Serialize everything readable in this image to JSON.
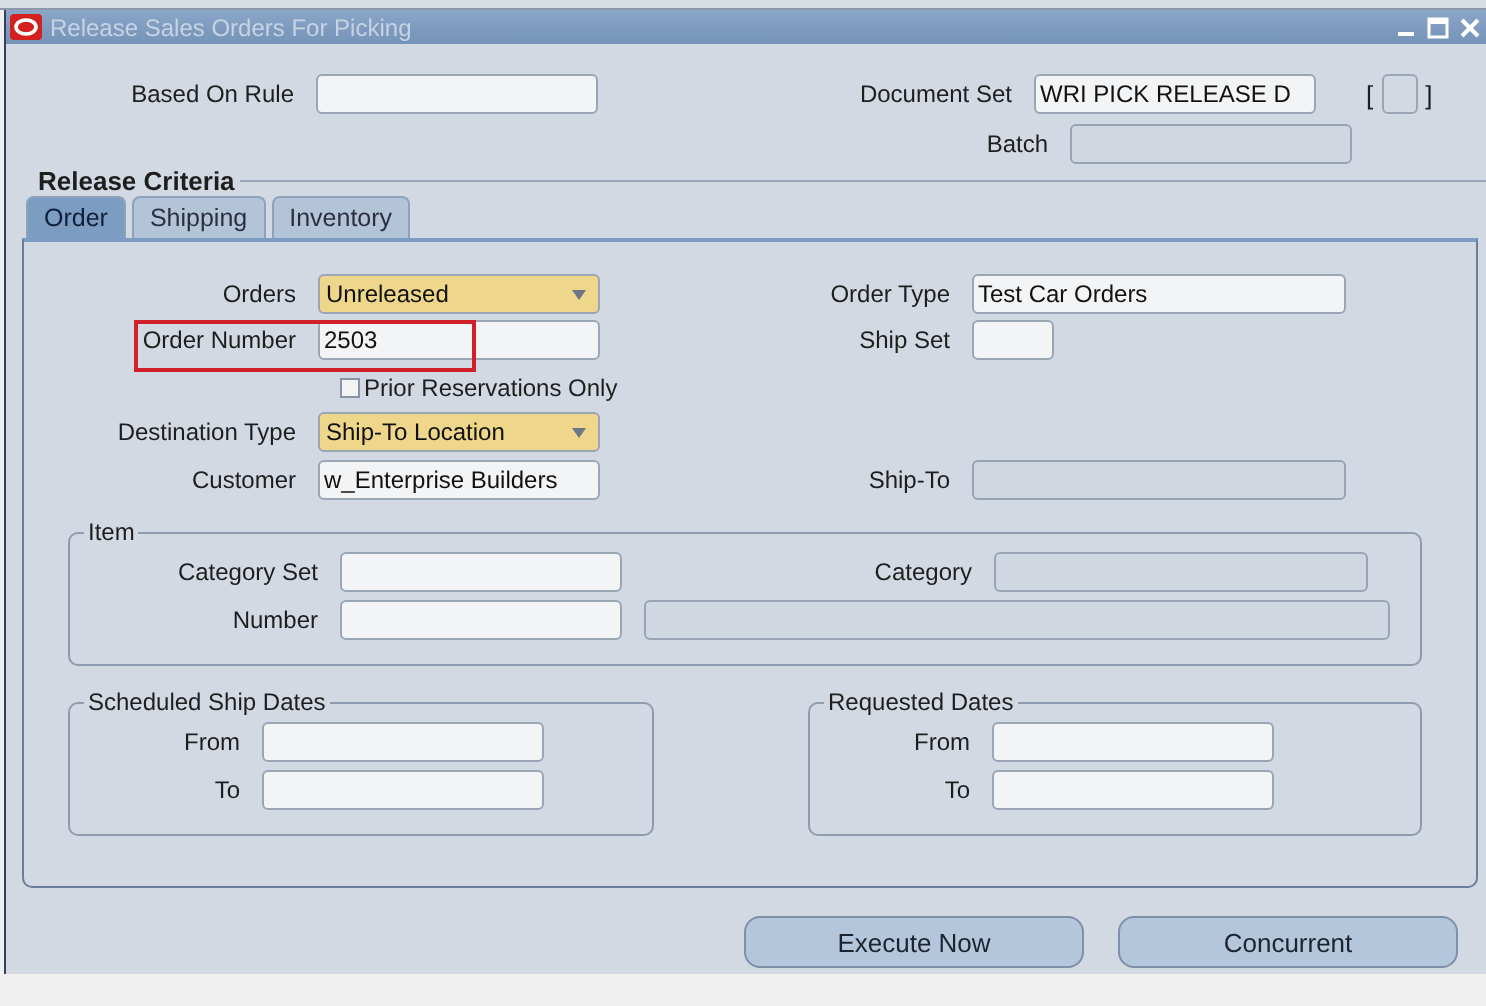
{
  "window": {
    "title": "Release Sales Orders For Picking"
  },
  "based_on_rule": {
    "label": "Based On Rule",
    "kind": "text",
    "disabled": false
  },
  "document_set": {
    "label": "Document Set",
    "kind": "text",
    "value": "WRI PICK RELEASE D",
    "disabled": false
  },
  "flex_field": {
    "open": "[",
    "close": "]"
  },
  "batch": {
    "label": "Batch",
    "kind": "text",
    "disabled": true
  },
  "section_title": "Release Criteria",
  "tabs": [
    {
      "label": "Order",
      "selected": true
    },
    {
      "label": "Shipping",
      "selected": false
    },
    {
      "label": "Inventory",
      "selected": false
    }
  ],
  "order_rows": [
    {
      "left": {
        "label": "Orders",
        "kind": "select",
        "value": "Unreleased",
        "disabled": false
      },
      "right": {
        "label": "Order Type",
        "kind": "text",
        "value": "Test Car Orders",
        "disabled": false
      }
    },
    {
      "left": {
        "label": "Order Number",
        "kind": "text",
        "value": "2503",
        "disabled": false,
        "highlighted": true
      },
      "right": {
        "label": "Ship Set",
        "kind": "text",
        "disabled": false
      }
    }
  ],
  "prior_reservations": {
    "label": "Prior Reservations Only",
    "checked": false
  },
  "customer_rows": [
    {
      "left": {
        "label": "Destination Type",
        "kind": "select",
        "value": "Ship-To Location",
        "disabled": false
      }
    },
    {
      "left": {
        "label": "Customer",
        "kind": "text",
        "value": "w_Enterprise Builders",
        "disabled": false
      },
      "right": {
        "label": "Ship-To",
        "kind": "text",
        "disabled": true
      }
    }
  ],
  "item_group": {
    "title": "Item",
    "category_set": {
      "label": "Category Set",
      "kind": "text",
      "disabled": false
    },
    "category": {
      "label": "Category",
      "kind": "text",
      "disabled": true
    },
    "number": {
      "label": "Number",
      "kind": "text",
      "disabled": false
    },
    "number_description": {
      "kind": "text",
      "disabled": true
    }
  },
  "date_groups": [
    {
      "title": "Scheduled Ship Dates",
      "fields": [
        {
          "label": "From",
          "kind": "text",
          "disabled": false
        },
        {
          "label": "To",
          "kind": "text",
          "disabled": false
        }
      ]
    },
    {
      "title": "Requested Dates",
      "fields": [
        {
          "label": "From",
          "kind": "text",
          "disabled": false
        },
        {
          "label": "To",
          "kind": "text",
          "disabled": false
        }
      ]
    }
  ],
  "buttons": [
    {
      "label": "Execute Now"
    },
    {
      "label": "Concurrent"
    }
  ]
}
